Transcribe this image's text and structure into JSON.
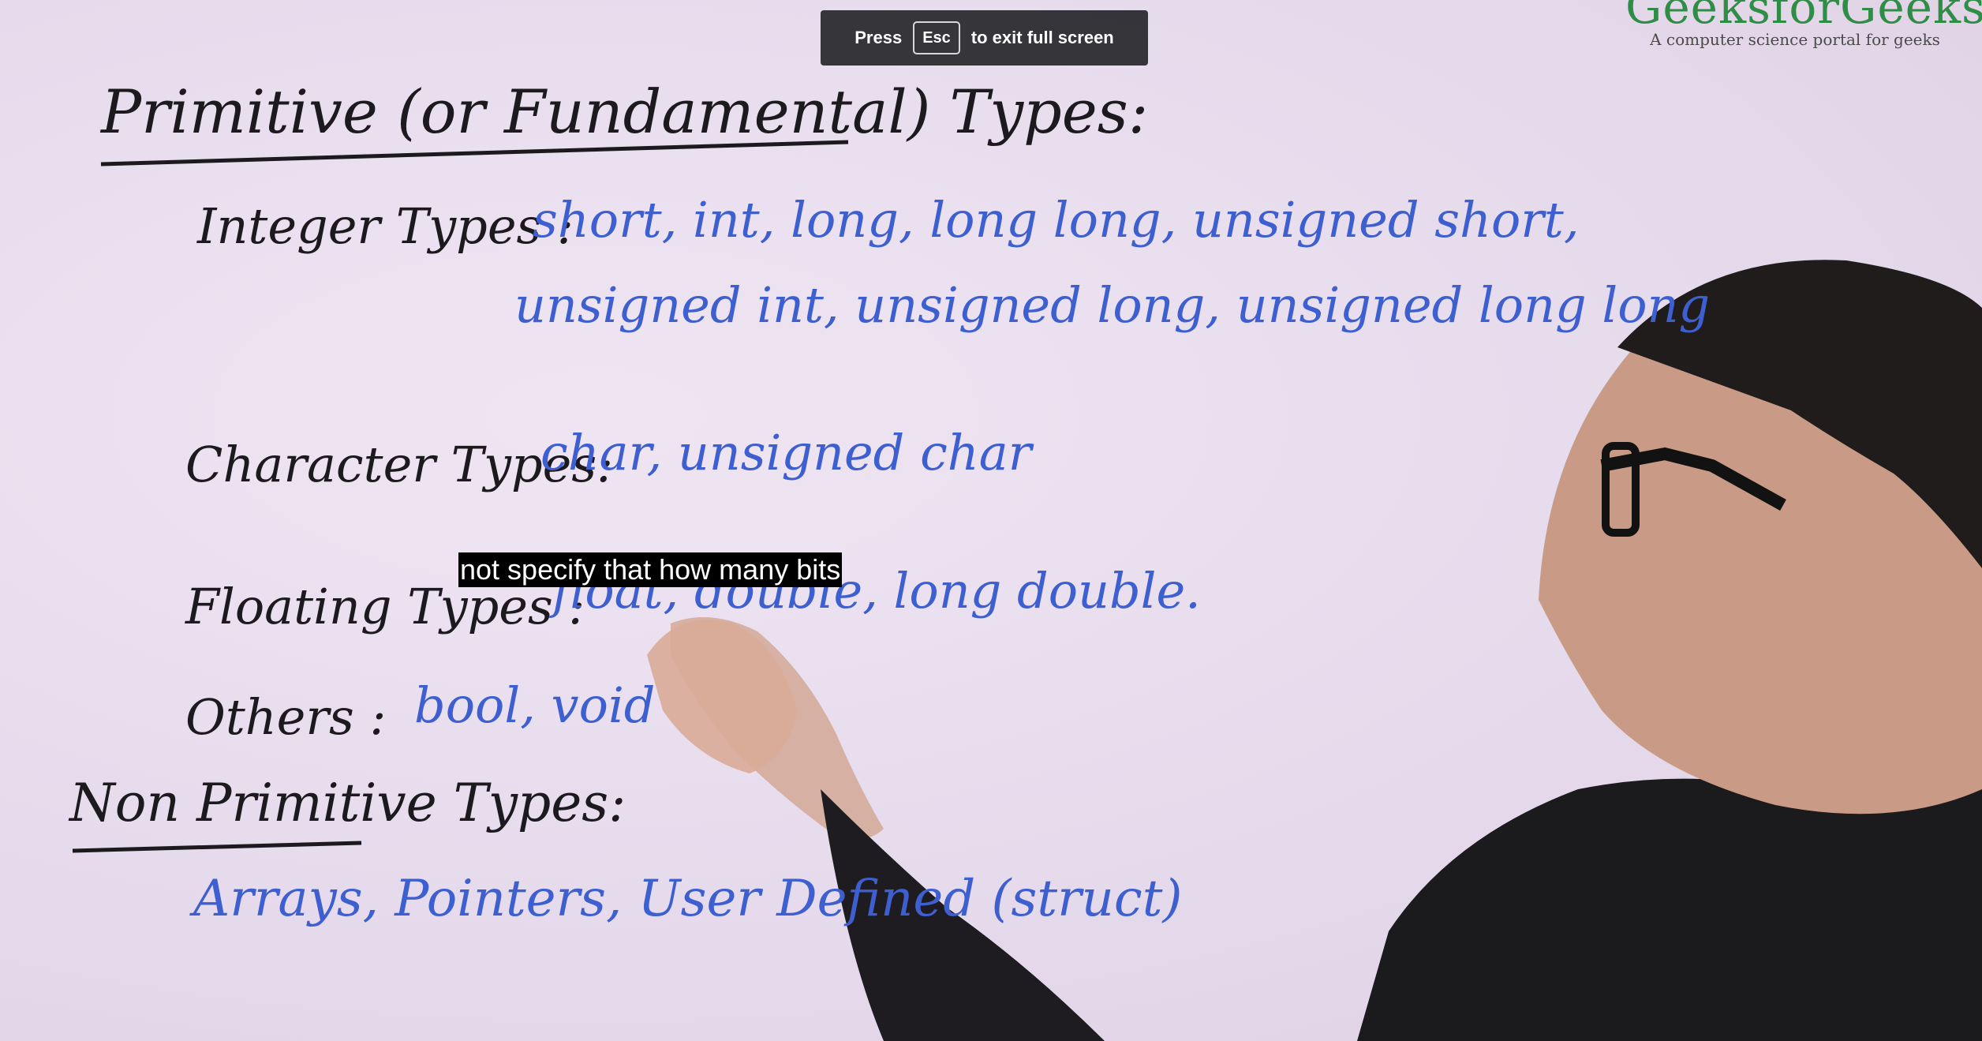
{
  "fullscreen_notice": {
    "press": "Press",
    "key": "Esc",
    "suffix": "to exit full screen"
  },
  "brand": {
    "name": "GeeksforGeeks",
    "tagline": "A computer science portal for geeks"
  },
  "caption": "not specify that how many bits",
  "whiteboard": {
    "primitive_heading": "Primitive (or Fundamental) Types:",
    "integer_label": "Integer Types :",
    "integer_line1": "short, int, long, long long, unsigned short,",
    "integer_line2": "unsigned int, unsigned long, unsigned long long",
    "character_label": "Character Types:",
    "character_values": "char, unsigned char",
    "floating_label": "Floating Types :",
    "floating_values": "float, double, long double.",
    "others_label": "Others :",
    "others_values": "bool, void",
    "non_primitive_heading": "Non Primitive Types:",
    "non_primitive_values": "Arrays, Pointers, User Defined (struct)"
  },
  "colors": {
    "ink_black": "#1d1a1f",
    "ink_blue": "#3d5fcf",
    "board": "#eadfee",
    "brand_green": "#2f8d46"
  }
}
